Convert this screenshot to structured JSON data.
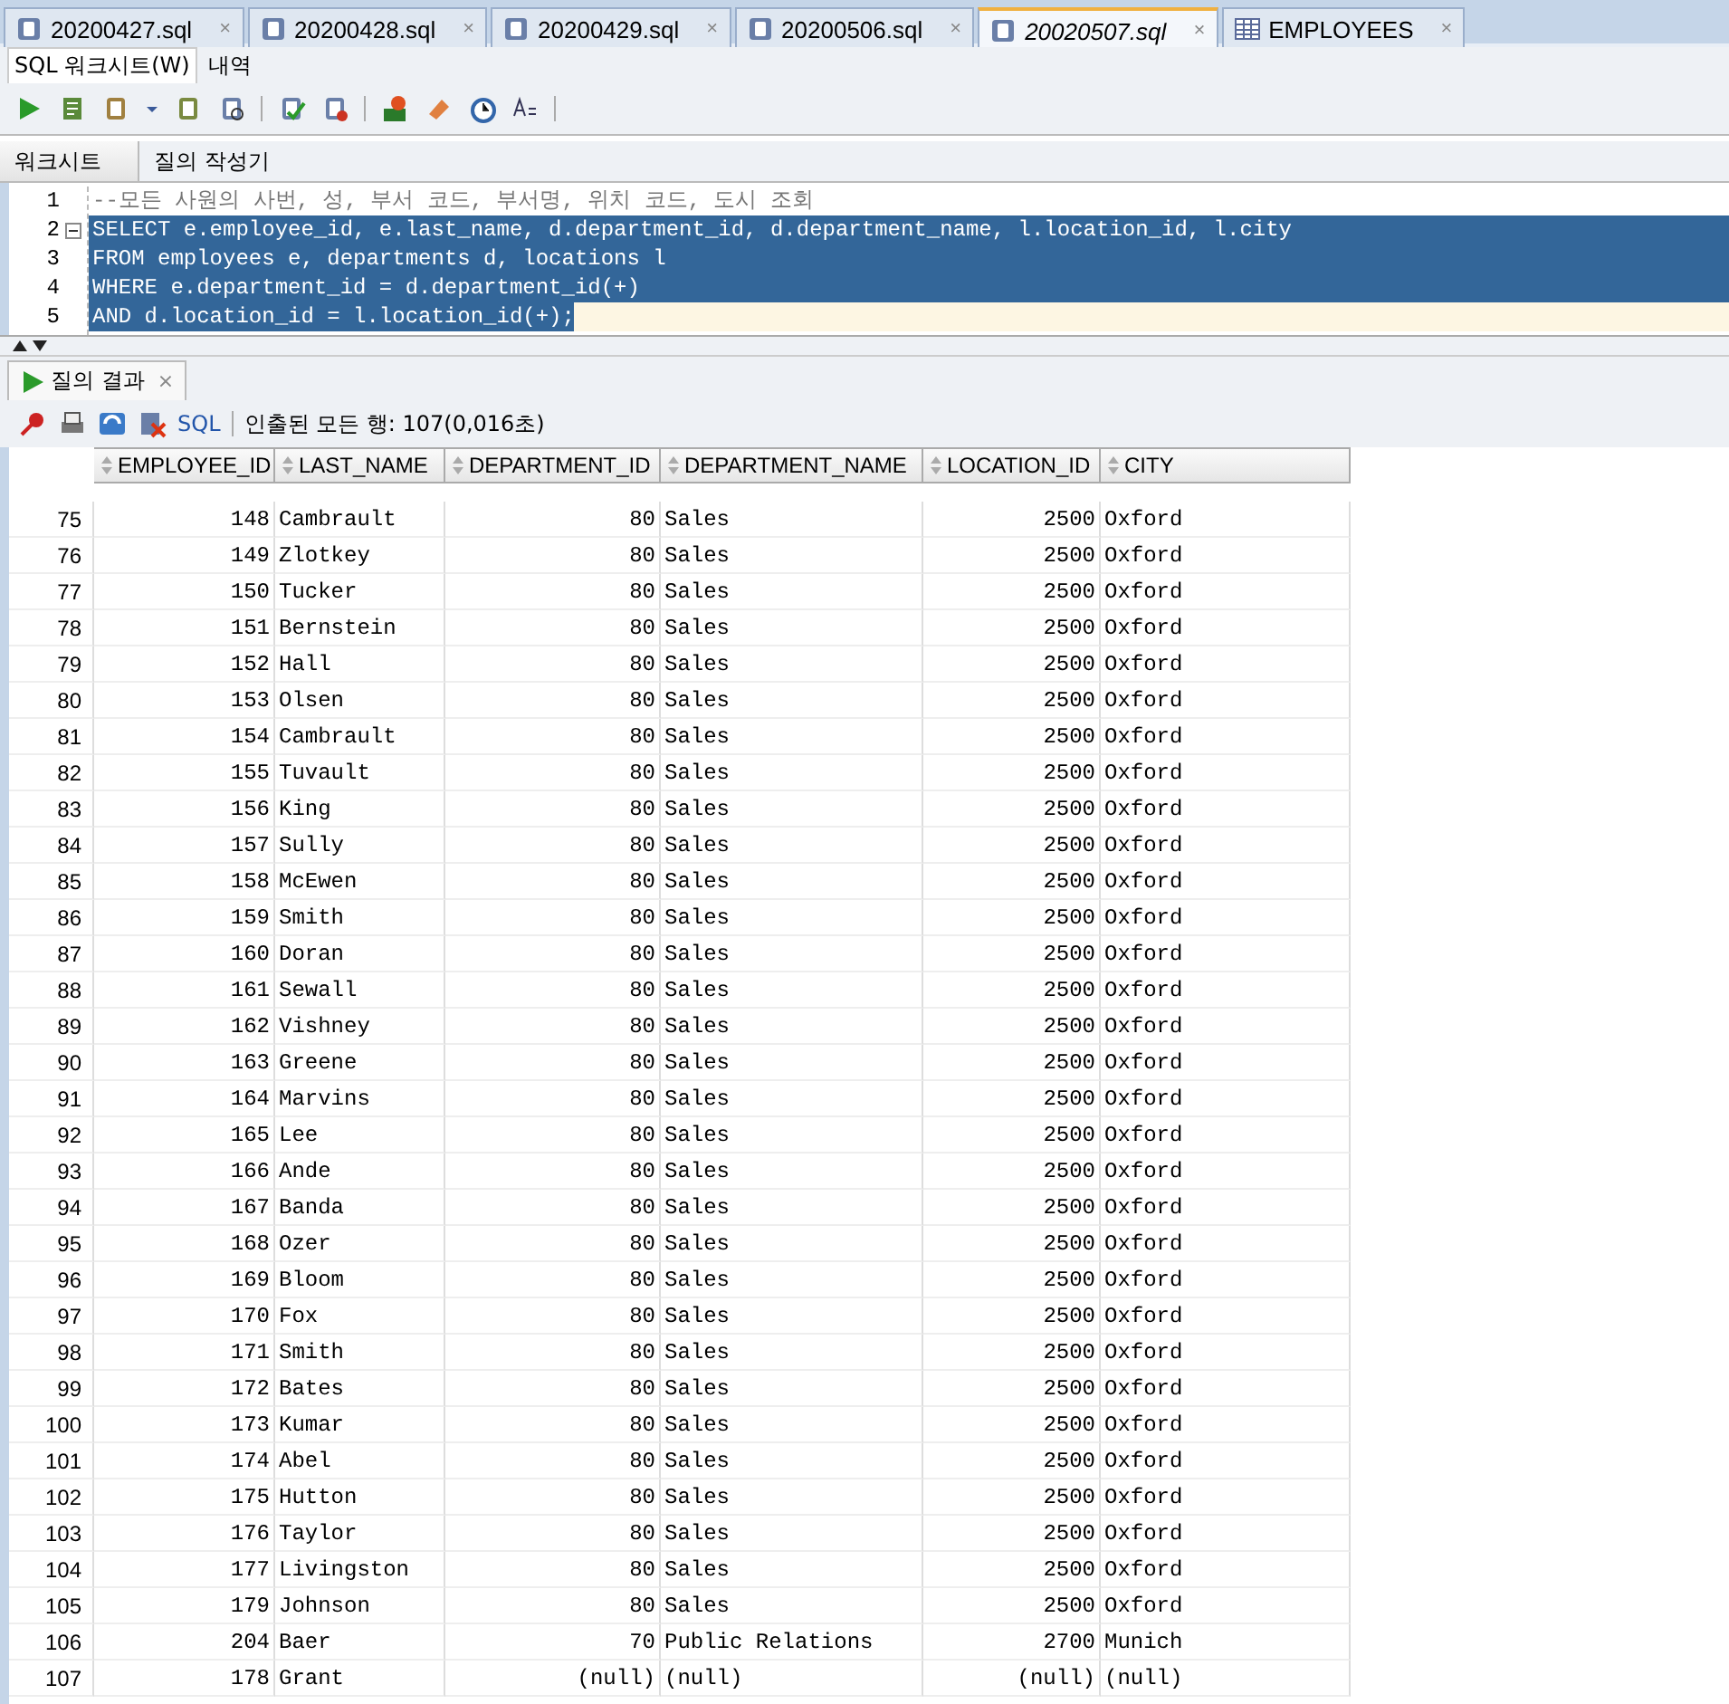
{
  "file_tabs": [
    {
      "label": "20200427.sql",
      "kind": "sql",
      "selected": false
    },
    {
      "label": "20200428.sql",
      "kind": "sql",
      "selected": false
    },
    {
      "label": "20200429.sql",
      "kind": "sql",
      "selected": false
    },
    {
      "label": "20200506.sql",
      "kind": "sql",
      "selected": false
    },
    {
      "label": "20020507.sql",
      "kind": "sql",
      "selected": true
    },
    {
      "label": "EMPLOYEES",
      "kind": "table",
      "selected": false
    }
  ],
  "close_glyph": "×",
  "view_tabs": [
    {
      "label": "SQL 워크시트(W)",
      "selected": true
    },
    {
      "label": "내역",
      "selected": false
    }
  ],
  "editor_tabs": [
    {
      "label": "워크시트",
      "selected": true
    },
    {
      "label": "질의 작성기",
      "selected": false
    }
  ],
  "editor_lines": [
    {
      "number": "1",
      "text": "--모든 사원의 사번, 성, 부서 코드, 부서명, 위치 코드, 도시 조회",
      "kind": "comment",
      "selected": false,
      "current": false
    },
    {
      "number": "2",
      "text": "SELECT e.employee_id, e.last_name, d.department_id, d.department_name, l.location_id, l.city",
      "kind": "code",
      "selected": true,
      "current": false
    },
    {
      "number": "3",
      "text": "FROM employees e, departments d, locations l",
      "kind": "code",
      "selected": true,
      "current": false
    },
    {
      "number": "4",
      "text": "WHERE e.department_id = d.department_id(+)",
      "kind": "code",
      "selected": true,
      "current": false
    },
    {
      "number": "5",
      "text": "AND d.location_id = l.location_id(+);",
      "kind": "code",
      "selected": true,
      "current": true
    }
  ],
  "result_tab": {
    "label": "질의 결과"
  },
  "result_toolbar": {
    "sql_link": "SQL",
    "status": "인출된 모든 행: 107(0,016초)"
  },
  "grid": {
    "columns": [
      "EMPLOYEE_ID",
      "LAST_NAME",
      "DEPARTMENT_ID",
      "DEPARTMENT_NAME",
      "LOCATION_ID",
      "CITY"
    ],
    "rows": [
      {
        "row_number": "75",
        "employee_id": "148",
        "last_name": "Cambrault",
        "department_id": "80",
        "department_name": "Sales",
        "location_id": "2500",
        "city": "Oxford"
      },
      {
        "row_number": "76",
        "employee_id": "149",
        "last_name": "Zlotkey",
        "department_id": "80",
        "department_name": "Sales",
        "location_id": "2500",
        "city": "Oxford"
      },
      {
        "row_number": "77",
        "employee_id": "150",
        "last_name": "Tucker",
        "department_id": "80",
        "department_name": "Sales",
        "location_id": "2500",
        "city": "Oxford"
      },
      {
        "row_number": "78",
        "employee_id": "151",
        "last_name": "Bernstein",
        "department_id": "80",
        "department_name": "Sales",
        "location_id": "2500",
        "city": "Oxford"
      },
      {
        "row_number": "79",
        "employee_id": "152",
        "last_name": "Hall",
        "department_id": "80",
        "department_name": "Sales",
        "location_id": "2500",
        "city": "Oxford"
      },
      {
        "row_number": "80",
        "employee_id": "153",
        "last_name": "Olsen",
        "department_id": "80",
        "department_name": "Sales",
        "location_id": "2500",
        "city": "Oxford"
      },
      {
        "row_number": "81",
        "employee_id": "154",
        "last_name": "Cambrault",
        "department_id": "80",
        "department_name": "Sales",
        "location_id": "2500",
        "city": "Oxford"
      },
      {
        "row_number": "82",
        "employee_id": "155",
        "last_name": "Tuvault",
        "department_id": "80",
        "department_name": "Sales",
        "location_id": "2500",
        "city": "Oxford"
      },
      {
        "row_number": "83",
        "employee_id": "156",
        "last_name": "King",
        "department_id": "80",
        "department_name": "Sales",
        "location_id": "2500",
        "city": "Oxford"
      },
      {
        "row_number": "84",
        "employee_id": "157",
        "last_name": "Sully",
        "department_id": "80",
        "department_name": "Sales",
        "location_id": "2500",
        "city": "Oxford"
      },
      {
        "row_number": "85",
        "employee_id": "158",
        "last_name": "McEwen",
        "department_id": "80",
        "department_name": "Sales",
        "location_id": "2500",
        "city": "Oxford"
      },
      {
        "row_number": "86",
        "employee_id": "159",
        "last_name": "Smith",
        "department_id": "80",
        "department_name": "Sales",
        "location_id": "2500",
        "city": "Oxford"
      },
      {
        "row_number": "87",
        "employee_id": "160",
        "last_name": "Doran",
        "department_id": "80",
        "department_name": "Sales",
        "location_id": "2500",
        "city": "Oxford"
      },
      {
        "row_number": "88",
        "employee_id": "161",
        "last_name": "Sewall",
        "department_id": "80",
        "department_name": "Sales",
        "location_id": "2500",
        "city": "Oxford"
      },
      {
        "row_number": "89",
        "employee_id": "162",
        "last_name": "Vishney",
        "department_id": "80",
        "department_name": "Sales",
        "location_id": "2500",
        "city": "Oxford"
      },
      {
        "row_number": "90",
        "employee_id": "163",
        "last_name": "Greene",
        "department_id": "80",
        "department_name": "Sales",
        "location_id": "2500",
        "city": "Oxford"
      },
      {
        "row_number": "91",
        "employee_id": "164",
        "last_name": "Marvins",
        "department_id": "80",
        "department_name": "Sales",
        "location_id": "2500",
        "city": "Oxford"
      },
      {
        "row_number": "92",
        "employee_id": "165",
        "last_name": "Lee",
        "department_id": "80",
        "department_name": "Sales",
        "location_id": "2500",
        "city": "Oxford"
      },
      {
        "row_number": "93",
        "employee_id": "166",
        "last_name": "Ande",
        "department_id": "80",
        "department_name": "Sales",
        "location_id": "2500",
        "city": "Oxford"
      },
      {
        "row_number": "94",
        "employee_id": "167",
        "last_name": "Banda",
        "department_id": "80",
        "department_name": "Sales",
        "location_id": "2500",
        "city": "Oxford"
      },
      {
        "row_number": "95",
        "employee_id": "168",
        "last_name": "Ozer",
        "department_id": "80",
        "department_name": "Sales",
        "location_id": "2500",
        "city": "Oxford"
      },
      {
        "row_number": "96",
        "employee_id": "169",
        "last_name": "Bloom",
        "department_id": "80",
        "department_name": "Sales",
        "location_id": "2500",
        "city": "Oxford"
      },
      {
        "row_number": "97",
        "employee_id": "170",
        "last_name": "Fox",
        "department_id": "80",
        "department_name": "Sales",
        "location_id": "2500",
        "city": "Oxford"
      },
      {
        "row_number": "98",
        "employee_id": "171",
        "last_name": "Smith",
        "department_id": "80",
        "department_name": "Sales",
        "location_id": "2500",
        "city": "Oxford"
      },
      {
        "row_number": "99",
        "employee_id": "172",
        "last_name": "Bates",
        "department_id": "80",
        "department_name": "Sales",
        "location_id": "2500",
        "city": "Oxford"
      },
      {
        "row_number": "100",
        "employee_id": "173",
        "last_name": "Kumar",
        "department_id": "80",
        "department_name": "Sales",
        "location_id": "2500",
        "city": "Oxford"
      },
      {
        "row_number": "101",
        "employee_id": "174",
        "last_name": "Abel",
        "department_id": "80",
        "department_name": "Sales",
        "location_id": "2500",
        "city": "Oxford"
      },
      {
        "row_number": "102",
        "employee_id": "175",
        "last_name": "Hutton",
        "department_id": "80",
        "department_name": "Sales",
        "location_id": "2500",
        "city": "Oxford"
      },
      {
        "row_number": "103",
        "employee_id": "176",
        "last_name": "Taylor",
        "department_id": "80",
        "department_name": "Sales",
        "location_id": "2500",
        "city": "Oxford"
      },
      {
        "row_number": "104",
        "employee_id": "177",
        "last_name": "Livingston",
        "department_id": "80",
        "department_name": "Sales",
        "location_id": "2500",
        "city": "Oxford"
      },
      {
        "row_number": "105",
        "employee_id": "179",
        "last_name": "Johnson",
        "department_id": "80",
        "department_name": "Sales",
        "location_id": "2500",
        "city": "Oxford"
      },
      {
        "row_number": "106",
        "employee_id": "204",
        "last_name": "Baer",
        "department_id": "70",
        "department_name": "Public Relations",
        "location_id": "2700",
        "city": "Munich"
      },
      {
        "row_number": "107",
        "employee_id": "178",
        "last_name": "Grant",
        "department_id": "(null)",
        "department_name": "(null)",
        "location_id": "(null)",
        "city": "(null)"
      }
    ]
  }
}
